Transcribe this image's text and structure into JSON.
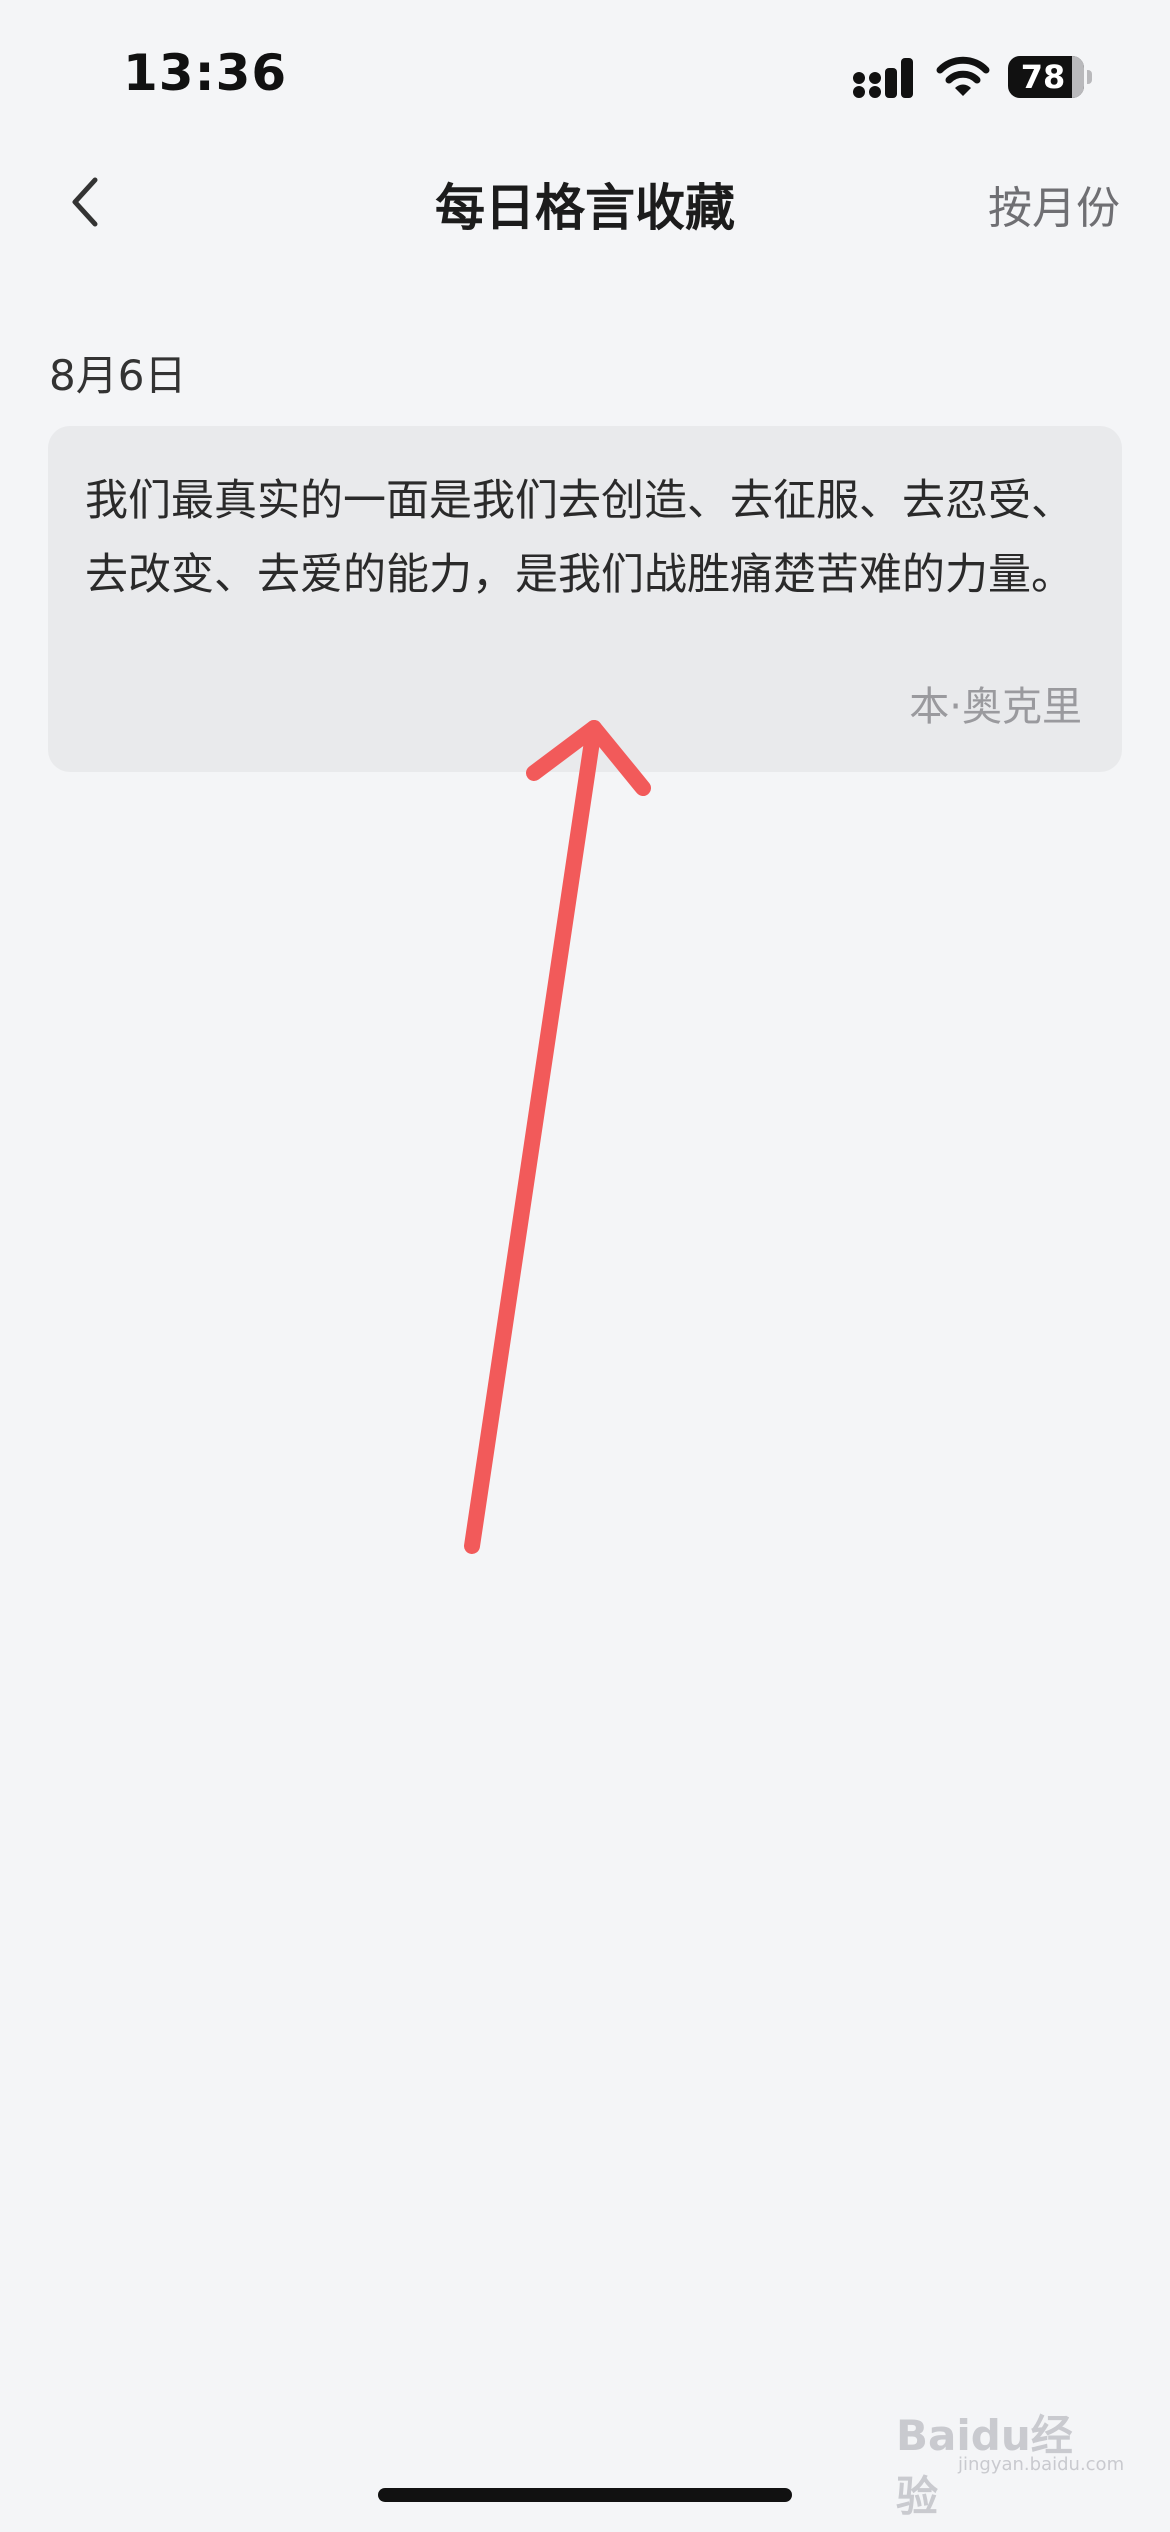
{
  "status_bar": {
    "time": "13:36",
    "battery_level": "78",
    "icons": [
      "signal-icon",
      "wifi-icon",
      "battery-icon"
    ]
  },
  "nav_bar": {
    "title": "每日格言收藏",
    "right_action": "按月份",
    "back_icon": "chevron-left-icon"
  },
  "entries": [
    {
      "date": "8月6日",
      "quote": "我们最真实的一面是我们去创造、去征服、去忍受、去改变、去爱的能力，是我们战胜痛楚苦难的力量。",
      "author": "本·奥克里"
    }
  ],
  "watermark": {
    "text": "Baidu经验",
    "sub": "jingyan.baidu.com"
  },
  "colors": {
    "background": "#f4f5f7",
    "card": "#e9eaec",
    "arrow": "#f25a5a",
    "title": "#1c1c1c",
    "secondary_text": "#9a9a9e"
  }
}
